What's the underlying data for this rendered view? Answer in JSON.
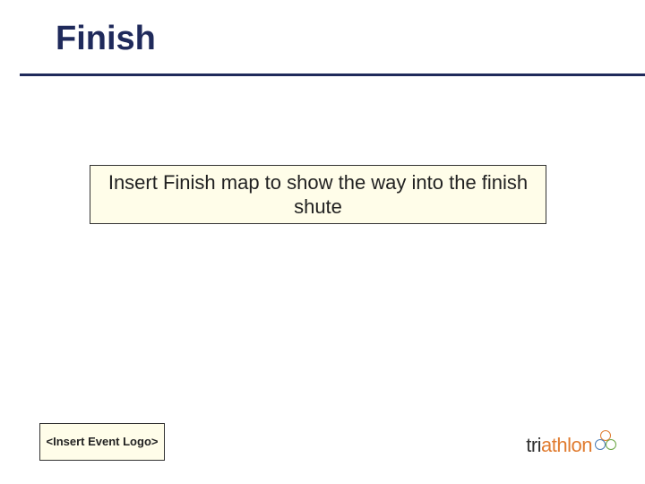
{
  "slide": {
    "title": "Finish",
    "placeholder_main": "Insert Finish map to show the way into the finish shute",
    "event_logo_placeholder": "<Insert Event Logo>",
    "brand": {
      "text_dark": "tri",
      "text_orange": "athlon"
    },
    "colors": {
      "accent": "#1f2a5b",
      "placeholder_bg": "#fffde9",
      "brand_orange": "#e07b2f"
    }
  }
}
